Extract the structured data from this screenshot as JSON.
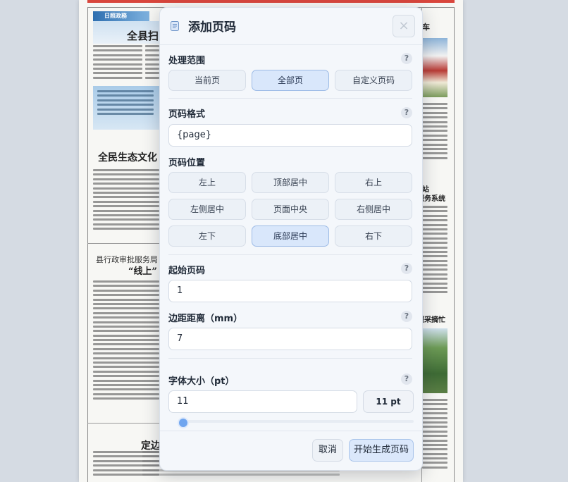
{
  "background_page": {
    "masthead": "日照政務",
    "headline_1": "全县扫",
    "headline_2": "全民生态文化",
    "feature_title_line1": "县行政审批服务局",
    "feature_title_line2": "“线上”",
    "headline_3": "定边",
    "right_col_label_1": "车",
    "right_col_label_2": "站",
    "right_col_label_3": "服务系统",
    "right_col_label_4": "服采摘忙",
    "accent_color": "#d9463c"
  },
  "modal": {
    "title": "添加页码",
    "close_label": "×",
    "icon": "document-icon",
    "scope": {
      "label": "处理范围",
      "help": "?",
      "options": [
        "当前页",
        "全部页",
        "自定义页码"
      ],
      "selected": "全部页"
    },
    "format": {
      "label": "页码格式",
      "help": "?",
      "value": "{page}"
    },
    "position": {
      "label": "页码位置",
      "options": [
        "左上",
        "顶部居中",
        "右上",
        "左侧居中",
        "页面中央",
        "右侧居中",
        "左下",
        "底部居中",
        "右下"
      ],
      "selected": "底部居中"
    },
    "start_page": {
      "label": "起始页码",
      "help": "?",
      "value": "1"
    },
    "margin": {
      "label": "边距距离（mm）",
      "help": "?",
      "value": "7"
    },
    "font_size": {
      "label": "字体大小（pt）",
      "help": "?",
      "value": "11",
      "badge": "11 pt",
      "slider_fraction": 0.0
    },
    "actions": {
      "cancel": "取消",
      "submit": "开始生成页码"
    },
    "colors": {
      "active_option_bg": "#d9e7fb",
      "active_option_border": "#9dbbe6",
      "slider_thumb": "#6fa5ef"
    }
  }
}
